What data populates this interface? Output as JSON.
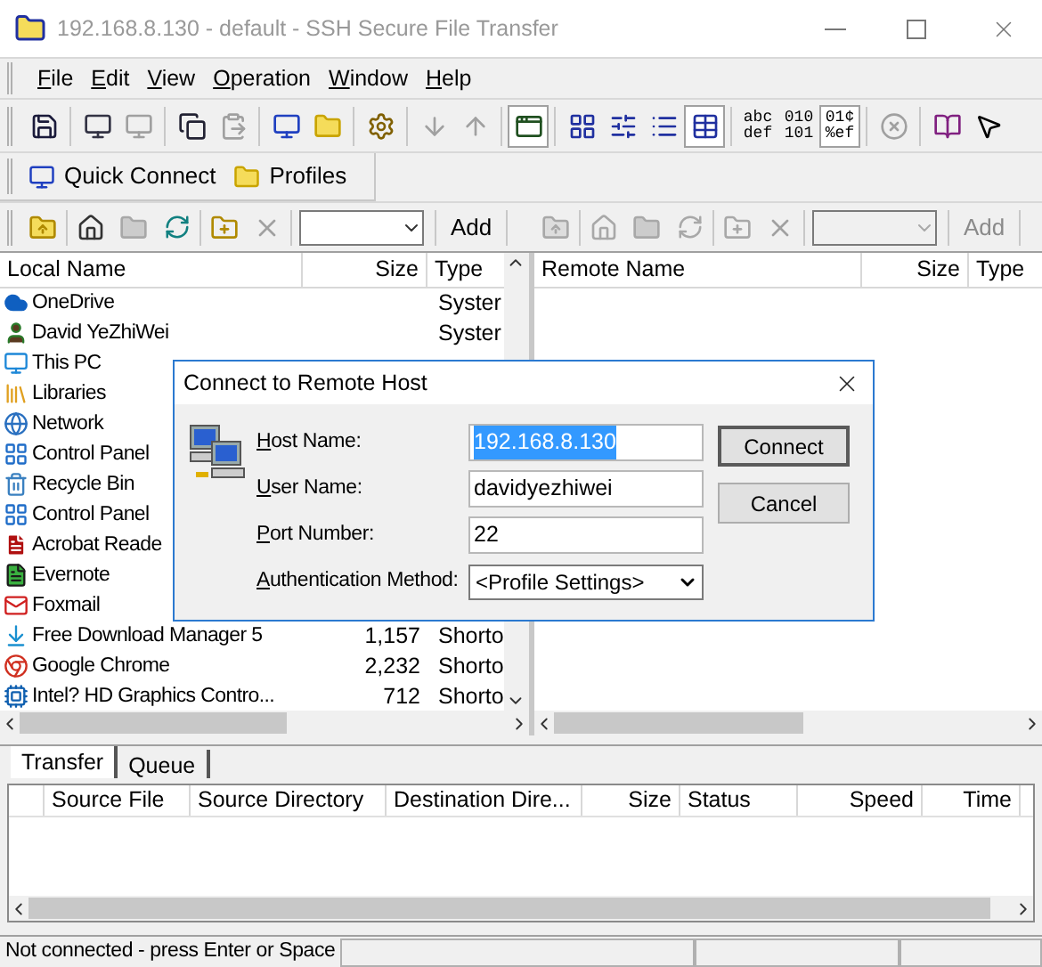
{
  "window": {
    "title": "192.168.8.130 - default - SSH Secure File Transfer"
  },
  "menu": [
    "File",
    "Edit",
    "View",
    "Operation",
    "Window",
    "Help"
  ],
  "toolbar": [
    {
      "kind": "save",
      "disabled": false,
      "pressed": false
    },
    {
      "kind": "separator"
    },
    {
      "kind": "terminal",
      "disabled": false,
      "pressed": false
    },
    {
      "kind": "terminal-grey",
      "disabled": true,
      "pressed": false
    },
    {
      "kind": "separator"
    },
    {
      "kind": "copy",
      "disabled": false,
      "pressed": false
    },
    {
      "kind": "paste",
      "disabled": true,
      "pressed": false
    },
    {
      "kind": "separator"
    },
    {
      "kind": "connect",
      "disabled": false,
      "pressed": false
    },
    {
      "kind": "profile",
      "disabled": false,
      "pressed": false
    },
    {
      "kind": "separator"
    },
    {
      "kind": "settings",
      "disabled": false,
      "pressed": false
    },
    {
      "kind": "separator"
    },
    {
      "kind": "download",
      "disabled": true,
      "pressed": false
    },
    {
      "kind": "upload",
      "disabled": true,
      "pressed": false
    },
    {
      "kind": "separator"
    },
    {
      "kind": "window",
      "disabled": false,
      "pressed": true
    },
    {
      "kind": "separator"
    },
    {
      "kind": "large-icons",
      "disabled": false,
      "pressed": false
    },
    {
      "kind": "small-icons",
      "disabled": false,
      "pressed": false
    },
    {
      "kind": "list",
      "disabled": false,
      "pressed": false
    },
    {
      "kind": "details",
      "disabled": false,
      "pressed": true
    },
    {
      "kind": "separator"
    },
    {
      "kind": "text",
      "lines": [
        "abc",
        "def"
      ],
      "disabled": false,
      "pressed": false
    },
    {
      "kind": "text",
      "lines": [
        "010",
        "101"
      ],
      "disabled": false,
      "pressed": false
    },
    {
      "kind": "text",
      "lines": [
        "01¢",
        "%ef"
      ],
      "disabled": false,
      "pressed": true
    },
    {
      "kind": "separator"
    },
    {
      "kind": "stop",
      "disabled": true,
      "pressed": false
    },
    {
      "kind": "separator"
    },
    {
      "kind": "help",
      "disabled": false,
      "pressed": false
    },
    {
      "kind": "whats-this",
      "disabled": false,
      "pressed": false
    }
  ],
  "quick_bar": [
    {
      "kind": "connect",
      "label": "Quick Connect"
    },
    {
      "kind": "folder",
      "label": "Profiles"
    }
  ],
  "local_toolbar": {
    "disabled": false,
    "add": "Add"
  },
  "remote_toolbar": {
    "disabled": true,
    "add": "Add"
  },
  "local": {
    "columns": [
      "Local Name",
      "Size",
      "Type"
    ],
    "rows": [
      {
        "kind": "cloud",
        "name": "OneDrive",
        "size": "",
        "type": "Syster"
      },
      {
        "kind": "user",
        "name": "David YeZhiWei",
        "size": "",
        "type": "Syster"
      },
      {
        "kind": "pc",
        "name": "This PC",
        "size": "",
        "type": ""
      },
      {
        "kind": "library",
        "name": "Libraries",
        "size": "",
        "type": ""
      },
      {
        "kind": "network",
        "name": "Network",
        "size": "",
        "type": ""
      },
      {
        "kind": "control",
        "name": "Control Panel",
        "size": "",
        "type": ""
      },
      {
        "kind": "recycle",
        "name": "Recycle Bin",
        "size": "",
        "type": ""
      },
      {
        "kind": "control",
        "name": "Control Panel",
        "size": "",
        "type": ""
      },
      {
        "kind": "acrobat",
        "name": "Acrobat Reade",
        "size": "",
        "type": ""
      },
      {
        "kind": "evernote",
        "name": "Evernote",
        "size": "",
        "type": ""
      },
      {
        "kind": "foxmail",
        "name": "Foxmail",
        "size": "",
        "type": ""
      },
      {
        "kind": "download",
        "name": "Free Download Manager 5",
        "size": "1,157",
        "type": "Shorto"
      },
      {
        "kind": "chrome",
        "name": "Google Chrome",
        "size": "2,232",
        "type": "Shorto"
      },
      {
        "kind": "intel",
        "name": "Intel? HD Graphics Contro...",
        "size": "712",
        "type": "Shorto"
      }
    ]
  },
  "remote": {
    "columns": [
      "Remote Name",
      "Size",
      "Type"
    ]
  },
  "transfer": {
    "tabs": [
      {
        "label": "Transfer",
        "selected": true
      },
      {
        "label": "Queue",
        "selected": false
      }
    ],
    "columns": [
      "Source File",
      "Source Directory",
      "Destination Dire...",
      "Size",
      "Status",
      "Speed",
      "Time"
    ]
  },
  "status_bar": {
    "text": "Not connected - press Enter or Space"
  },
  "dialog": {
    "title": "Connect to Remote Host",
    "fields": [
      {
        "kind": "text",
        "label": "Host Name:",
        "value": "192.168.8.130",
        "selected": true
      },
      {
        "kind": "text",
        "label": "User Name:",
        "value": "davidyezhiwei",
        "selected": false
      },
      {
        "kind": "text",
        "label": "Port Number:",
        "value": "22",
        "selected": false
      },
      {
        "kind": "select",
        "label": "Authentication Method:",
        "value": "<Profile Settings>",
        "selected": false
      }
    ],
    "buttons": [
      "Connect",
      "Cancel"
    ]
  }
}
